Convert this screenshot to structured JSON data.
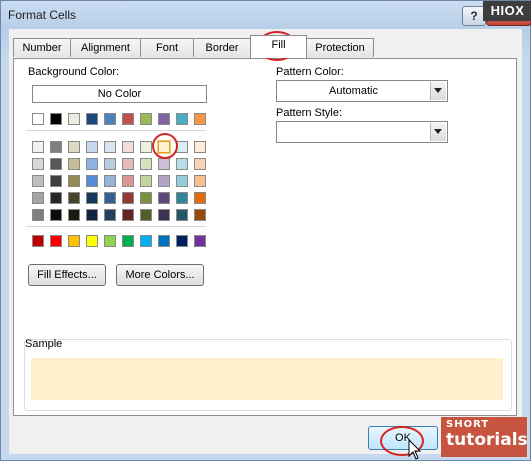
{
  "window": {
    "title": "Format Cells"
  },
  "titlebar": {
    "help_label": "?"
  },
  "watermark": {
    "hiox": "HIOX",
    "short": "SHORT",
    "tutorials": "tutorials"
  },
  "tabs": [
    {
      "label": "Number"
    },
    {
      "label": "Alignment"
    },
    {
      "label": "Font"
    },
    {
      "label": "Border"
    },
    {
      "label": "Fill",
      "active": true
    },
    {
      "label": "Protection"
    }
  ],
  "fill": {
    "background_color_label": "Background Color:",
    "no_color_label": "No Color",
    "fill_effects_label": "Fill Effects...",
    "more_colors_label": "More Colors...",
    "selected_swatch_color": "#fff2cc",
    "theme_colors_top": [
      "#ffffff",
      "#000000",
      "#eeece1",
      "#1f497d",
      "#4f81bd",
      "#c0504d",
      "#9bbb59",
      "#8064a2",
      "#4bacc6",
      "#f79646"
    ],
    "theme_colors": [
      [
        "#f2f2f2",
        "#7f7f7f",
        "#ddd9c3",
        "#c6d9f0",
        "#dbe5f1",
        "#f2dcdb",
        "#ebf1dd",
        "#e5e0ec",
        "#dbeef3",
        "#fdeada"
      ],
      [
        "#d8d8d8",
        "#595959",
        "#c4bd97",
        "#8db3e2",
        "#b8cce4",
        "#e5b9b7",
        "#d7e3bc",
        "#ccc1d9",
        "#b7dde8",
        "#fbd5b5"
      ],
      [
        "#bfbfbf",
        "#3f3f3f",
        "#938953",
        "#548dd4",
        "#95b3d7",
        "#d99694",
        "#c3d69b",
        "#b2a2c7",
        "#92cddc",
        "#fac08f"
      ],
      [
        "#a5a5a5",
        "#262626",
        "#494429",
        "#17365d",
        "#366092",
        "#953734",
        "#76923c",
        "#5f497a",
        "#31859b",
        "#e36c09"
      ],
      [
        "#7f7f7f",
        "#0c0c0c",
        "#1d1b10",
        "#0f243e",
        "#244061",
        "#632423",
        "#4f6128",
        "#3f3151",
        "#205867",
        "#974806"
      ]
    ],
    "standard_colors": [
      "#c00000",
      "#ff0000",
      "#ffc000",
      "#ffff00",
      "#92d050",
      "#00b050",
      "#00b0f0",
      "#0070c0",
      "#002060",
      "#7030a0"
    ],
    "pattern_color_label": "Pattern Color:",
    "pattern_color_value": "Automatic",
    "pattern_style_label": "Pattern Style:",
    "pattern_style_value": "",
    "sample_label": "Sample",
    "sample_color": "#fff0cc"
  },
  "footer": {
    "ok_label": "OK"
  }
}
